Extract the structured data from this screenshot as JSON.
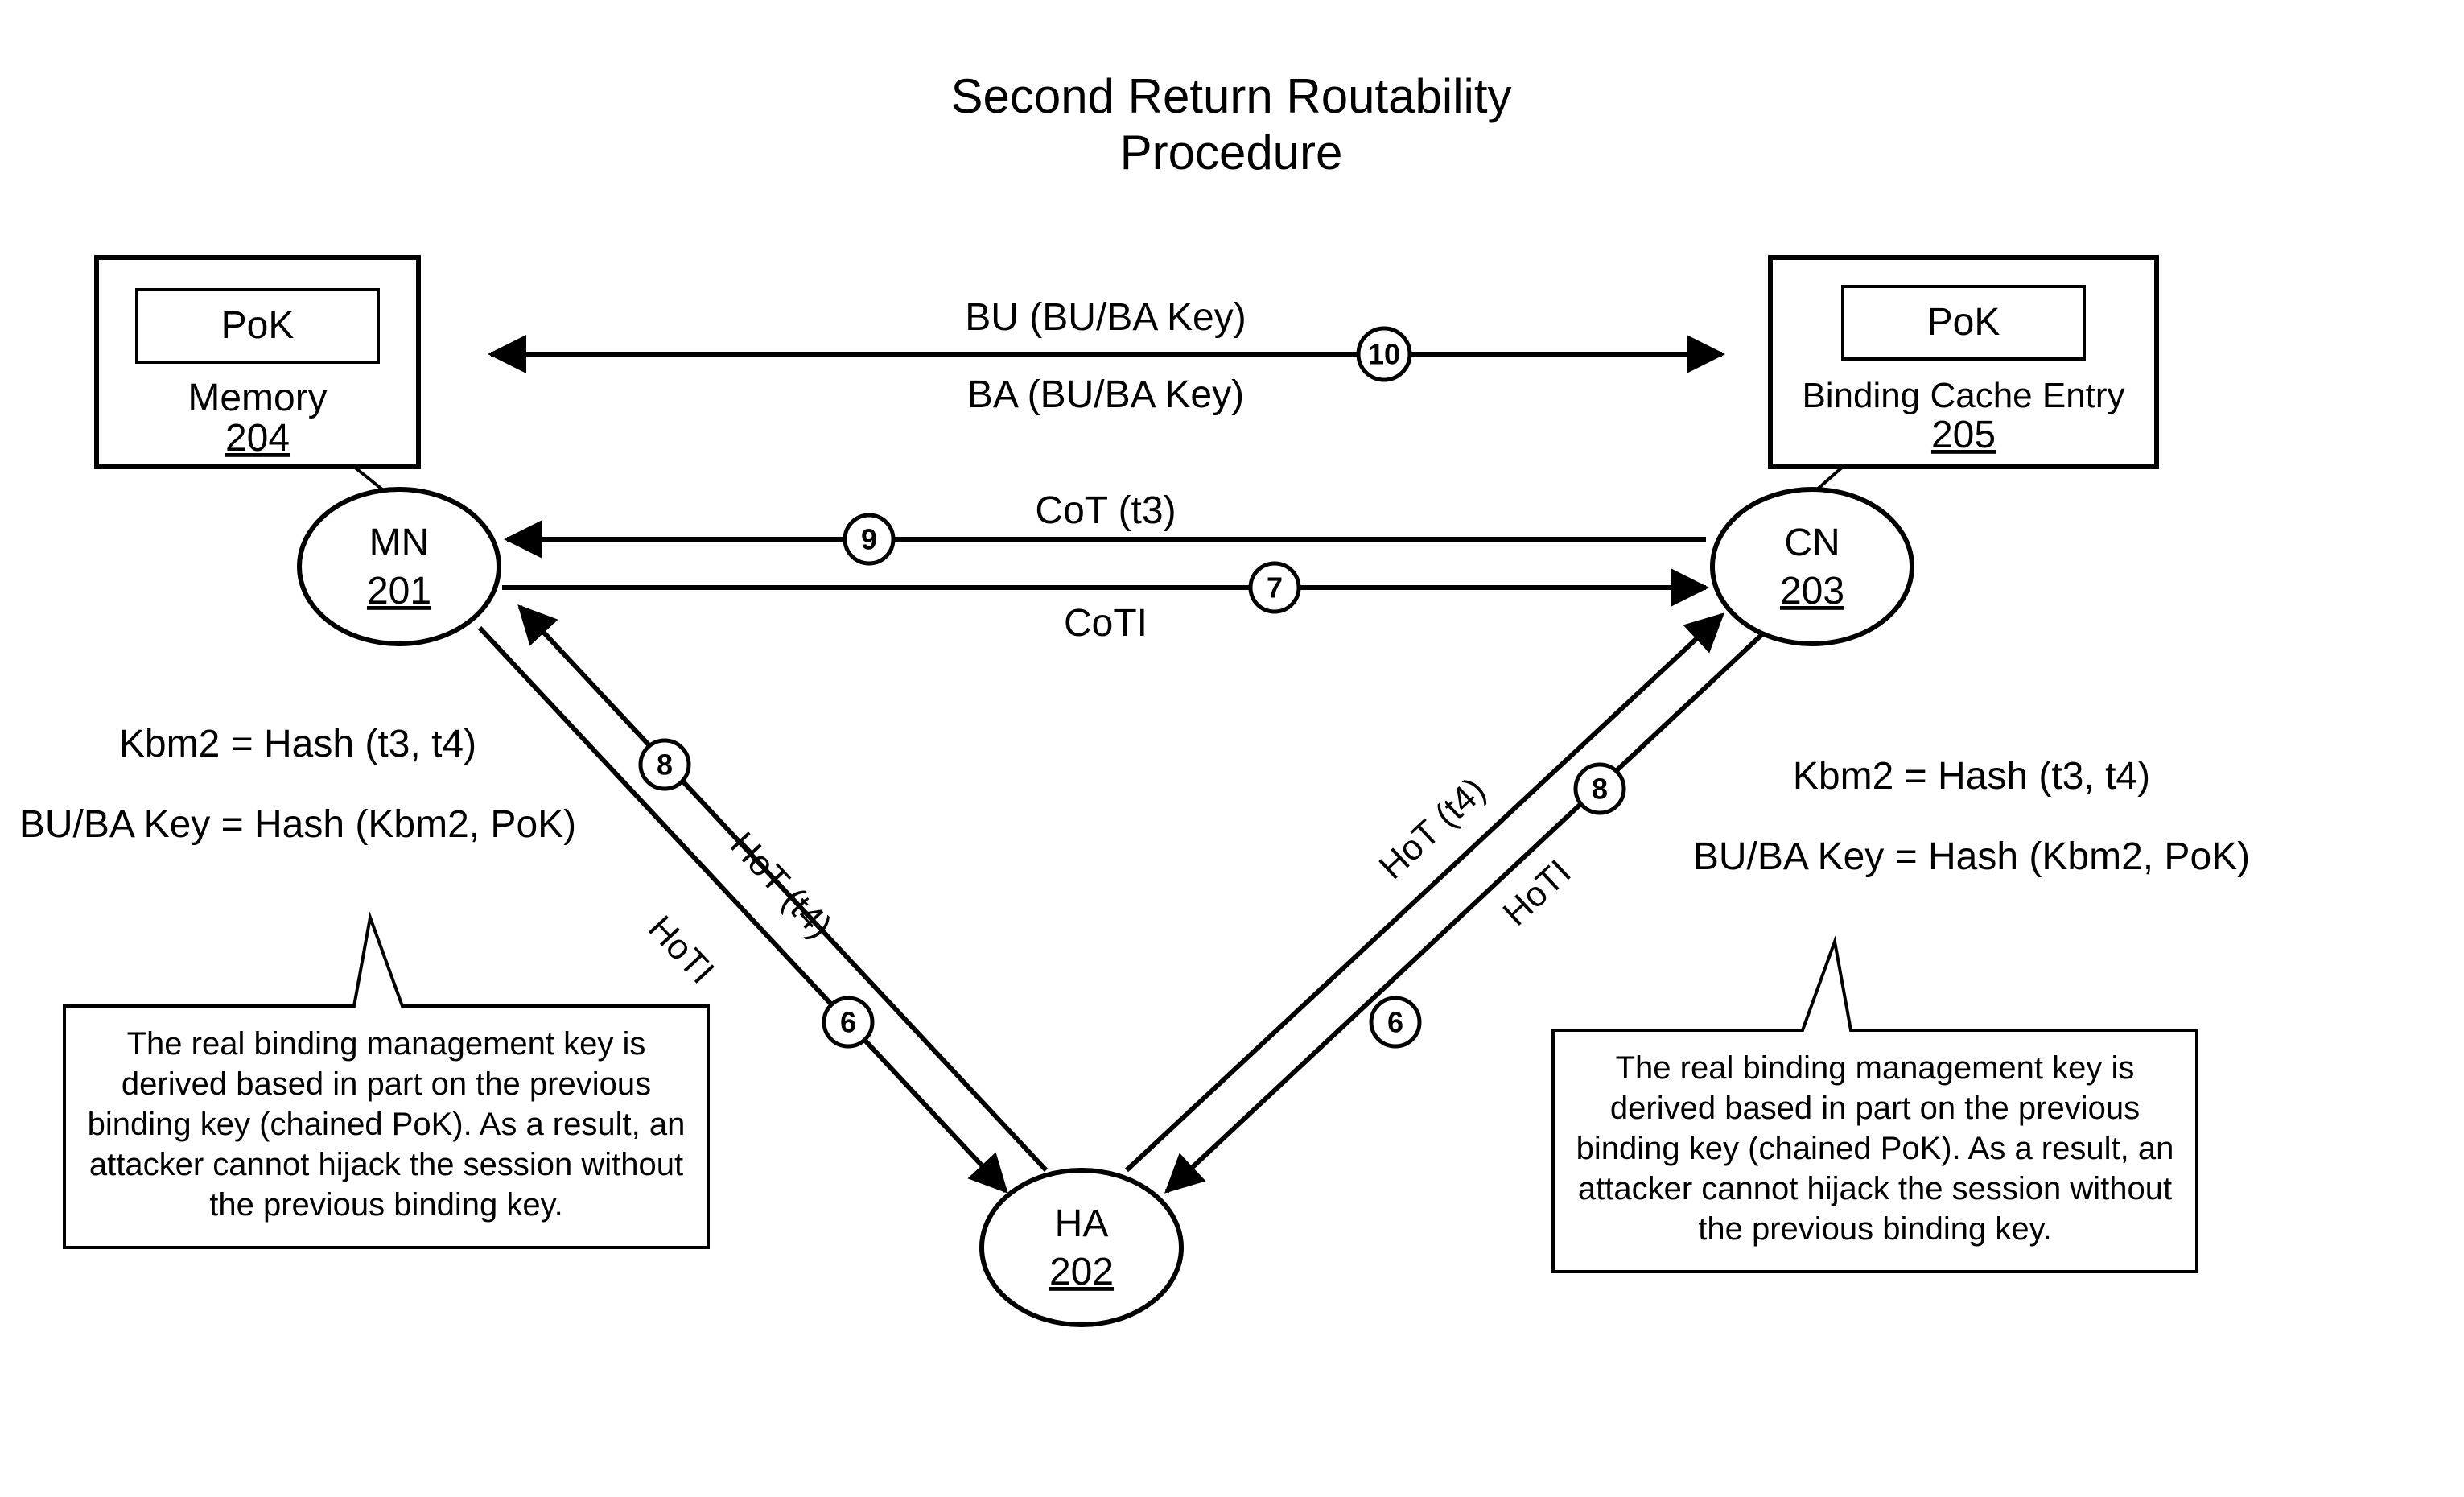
{
  "title_line1": "Second Return Routability",
  "title_line2": "Procedure",
  "mn": {
    "label": "MN",
    "id": "201"
  },
  "ha": {
    "label": "HA",
    "id": "202"
  },
  "cn": {
    "label": "CN",
    "id": "203"
  },
  "memory_box": {
    "pok": "PoK",
    "label": "Memory",
    "id": "204"
  },
  "cache_box": {
    "pok": "PoK",
    "label": "Binding Cache Entry",
    "id": "205"
  },
  "top_arrow": {
    "bu": "BU (BU/BA Key)",
    "ba": "BA (BU/BA Key)",
    "step": "10"
  },
  "mn_cn_cot": {
    "label": "CoT (t3)",
    "step": "9"
  },
  "mn_cn_coti": {
    "label": "CoTI",
    "step": "7"
  },
  "mn_ha_down": {
    "label": "HoTI",
    "step": "6"
  },
  "mn_ha_up": {
    "label": "HoT (t4)",
    "step": "8"
  },
  "cn_ha_down": {
    "label": "HoTI",
    "step": "6"
  },
  "cn_ha_up": {
    "label": "HoT (t4)",
    "step": "8"
  },
  "formula_left": {
    "line1": "Kbm2 = Hash (t3, t4)",
    "line2": "BU/BA Key = Hash (Kbm2, PoK)"
  },
  "formula_right": {
    "line1": "Kbm2 = Hash (t3, t4)",
    "line2": "BU/BA Key = Hash (Kbm2, PoK)"
  },
  "callout_left": {
    "l1": "The real binding management key is",
    "l2": "derived based in part on the previous",
    "l3": "binding key (chained PoK). As a result, an",
    "l4": "attacker cannot hijack the session without",
    "l5": "the previous binding key."
  },
  "callout_right": {
    "l1": "The real binding management key is",
    "l2": "derived based in part on the previous",
    "l3": "binding key (chained PoK). As a result, an",
    "l4": "attacker cannot hijack the session without",
    "l5": "the previous binding key."
  }
}
